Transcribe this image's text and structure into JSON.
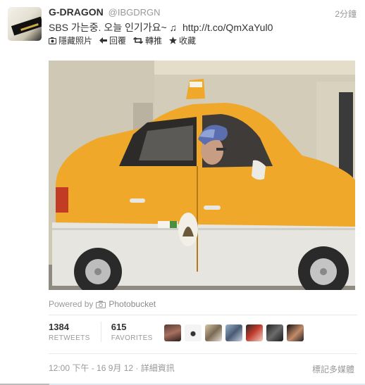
{
  "tweet": {
    "fullname": "G-DRAGON",
    "username": "@IBGDRGN",
    "time": "2分鐘",
    "text": "SBS 가는중. 오늘 인기가요~ ♫",
    "link": "http://t.co/QmXaYul0",
    "actions": {
      "hide_photo": "隱藏照片",
      "reply": "回覆",
      "retweet": "轉推",
      "favorite": "收藏"
    },
    "powered_by": "Powered by",
    "provider": "Photobucket",
    "retweets_count": "1384",
    "retweets_label": "RETWEETS",
    "favorites_count": "615",
    "favorites_label": "FAVORITES",
    "timestamp": "12:00 下午 - 16 9月 12",
    "separator": "·",
    "details": "詳細資訊",
    "flag_media": "標記多媒體"
  },
  "colors": {
    "taxi_yellow": "#f0a82a",
    "taxi_white": "#e9e9e6",
    "text": "#333333",
    "muted": "#999999"
  }
}
